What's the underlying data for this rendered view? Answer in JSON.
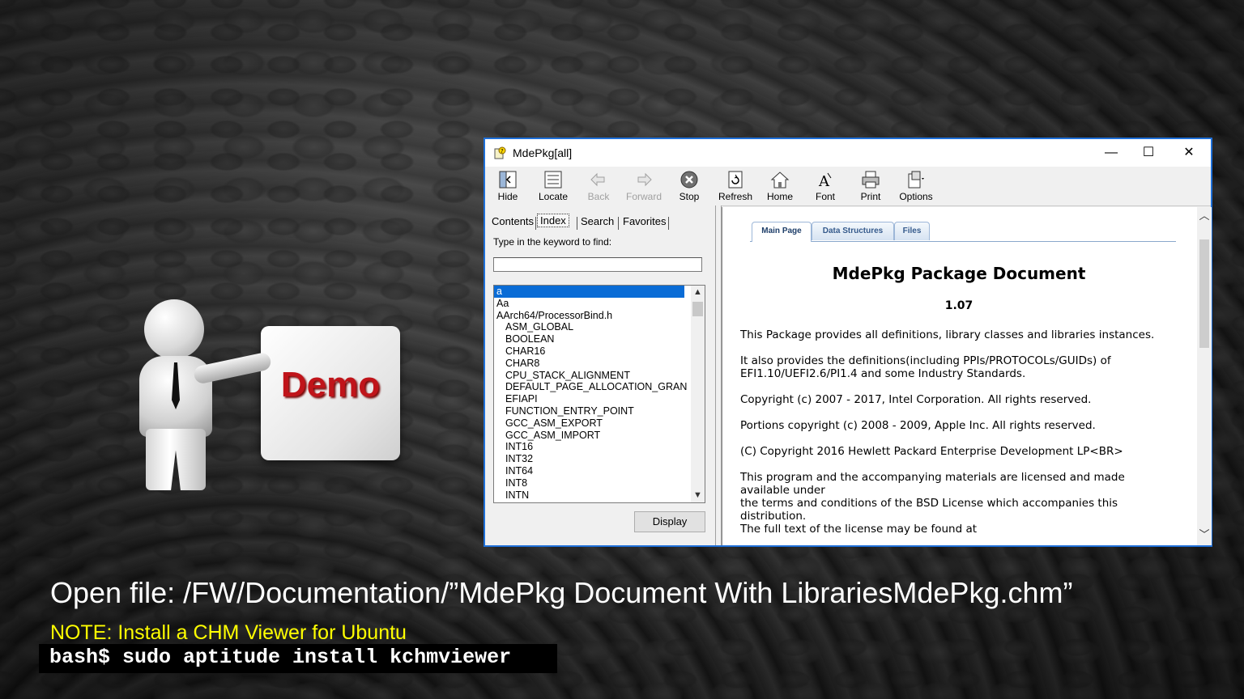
{
  "window": {
    "title": "MdePkg[all]",
    "controls": {
      "minimize": "—",
      "maximize": "☐",
      "close": "✕"
    }
  },
  "toolbar": {
    "buttons": [
      {
        "label": "Hide",
        "icon": "hide-icon",
        "enabled": true
      },
      {
        "label": "Locate",
        "icon": "locate-icon",
        "enabled": true
      },
      {
        "label": "Back",
        "icon": "back-arrow-icon",
        "enabled": false
      },
      {
        "label": "Forward",
        "icon": "forward-arrow-icon",
        "enabled": false
      },
      {
        "label": "Stop",
        "icon": "stop-icon",
        "enabled": true
      },
      {
        "label": "Refresh",
        "icon": "refresh-icon",
        "enabled": true
      },
      {
        "label": "Home",
        "icon": "home-icon",
        "enabled": true
      },
      {
        "label": "Font",
        "icon": "font-icon",
        "enabled": true
      },
      {
        "label": "Print",
        "icon": "printer-icon",
        "enabled": true
      },
      {
        "label": "Options",
        "icon": "options-icon",
        "enabled": true
      }
    ]
  },
  "navpane": {
    "tabs": [
      "Contents",
      "Index",
      "Search",
      "Favorites"
    ],
    "active_tab": "Index",
    "keyword_label": "Type in the keyword to find:",
    "keyword_value": "",
    "index_items": [
      {
        "text": "a",
        "indent": false,
        "selected": true
      },
      {
        "text": "Aa",
        "indent": false,
        "selected": false
      },
      {
        "text": "AArch64/ProcessorBind.h",
        "indent": false,
        "selected": false
      },
      {
        "text": "ASM_GLOBAL",
        "indent": true,
        "selected": false
      },
      {
        "text": "BOOLEAN",
        "indent": true,
        "selected": false
      },
      {
        "text": "CHAR16",
        "indent": true,
        "selected": false
      },
      {
        "text": "CHAR8",
        "indent": true,
        "selected": false
      },
      {
        "text": "CPU_STACK_ALIGNMENT",
        "indent": true,
        "selected": false
      },
      {
        "text": "DEFAULT_PAGE_ALLOCATION_GRAN",
        "indent": true,
        "selected": false
      },
      {
        "text": "EFIAPI",
        "indent": true,
        "selected": false
      },
      {
        "text": "FUNCTION_ENTRY_POINT",
        "indent": true,
        "selected": false
      },
      {
        "text": "GCC_ASM_EXPORT",
        "indent": true,
        "selected": false
      },
      {
        "text": "GCC_ASM_IMPORT",
        "indent": true,
        "selected": false
      },
      {
        "text": "INT16",
        "indent": true,
        "selected": false
      },
      {
        "text": "INT32",
        "indent": true,
        "selected": false
      },
      {
        "text": "INT64",
        "indent": true,
        "selected": false
      },
      {
        "text": "INT8",
        "indent": true,
        "selected": false
      },
      {
        "text": "INTN",
        "indent": true,
        "selected": false
      }
    ],
    "display_button": "Display"
  },
  "document": {
    "tabs": [
      "Main Page",
      "Data Structures",
      "Files"
    ],
    "active_tab": "Main Page",
    "title": "MdePkg Package Document",
    "version": "1.07",
    "paragraphs": [
      "This Package provides all definitions, library classes and libraries instances.",
      "It also provides the definitions(including PPIs/PROTOCOLs/GUIDs) of EFI1.10/UEFI2.6/PI1.4 and some Industry Standards.",
      "Copyright (c) 2007 - 2017, Intel Corporation. All rights reserved.",
      "Portions copyright (c) 2008 - 2009, Apple Inc. All rights reserved.",
      "(C) Copyright 2016 Hewlett Packard Enterprise Development LP<BR>",
      "This program and the accompanying materials are licensed and made available under\nthe terms and conditions of the BSD License which accompanies this distribution.\nThe full text of the license may be found at"
    ]
  },
  "slide": {
    "demo_label": "Demo",
    "caption": "Open file: /FW/Documentation/”MdePkg Document With LibrariesMdePkg.chm”",
    "note": "NOTE:  Install a CHM Viewer for Ubuntu",
    "command": "bash$ sudo aptitude install kchmviewer"
  },
  "colors": {
    "demo_text": "#c0141a",
    "note_text": "#ffff00",
    "selection": "#0a6cd6",
    "window_border": "#1e6fd8"
  }
}
